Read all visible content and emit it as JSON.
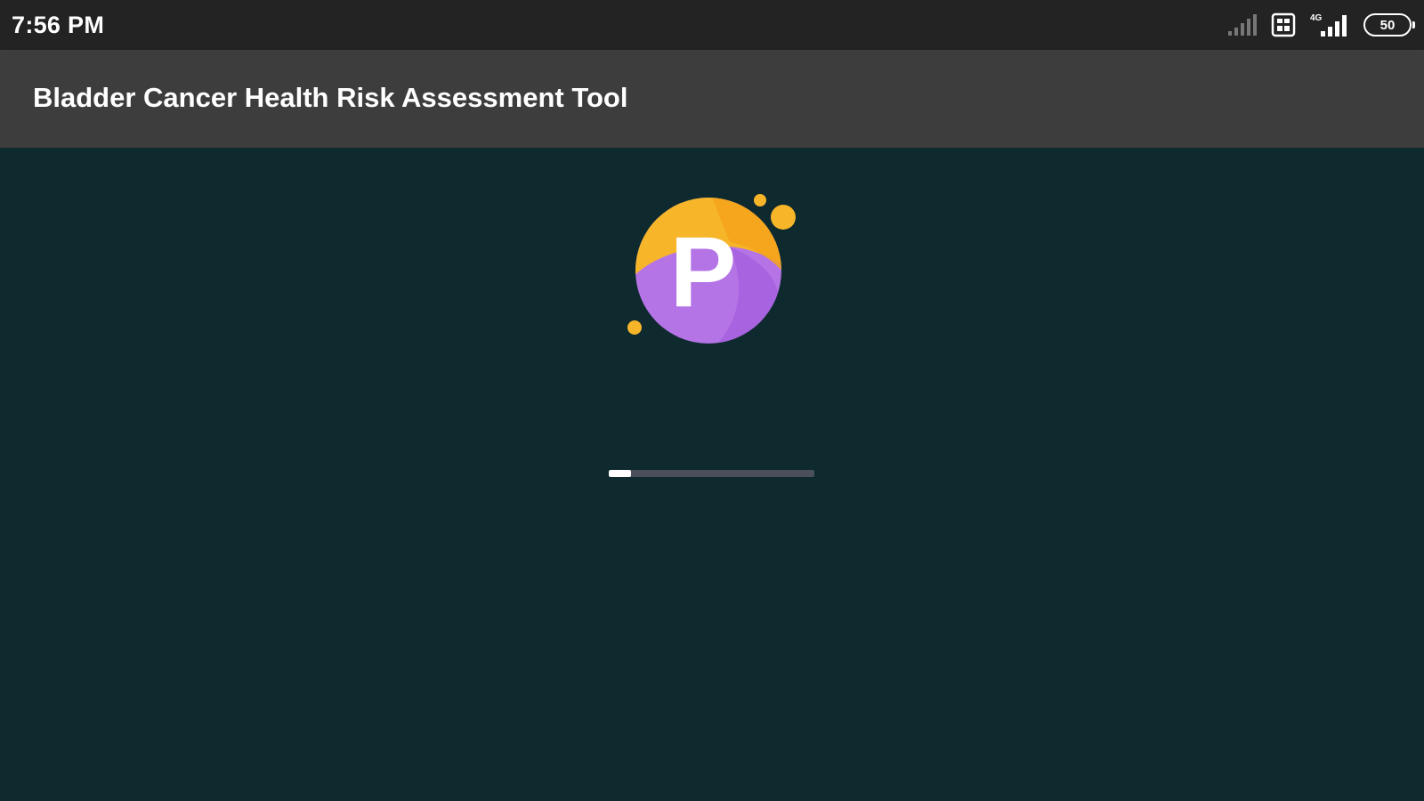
{
  "status_bar": {
    "time": "7:56 PM",
    "network_type": "4G",
    "battery_level": "50",
    "icons": [
      "signal-weak-icon",
      "sim-card-icon",
      "signal-4g-icon",
      "battery-icon"
    ]
  },
  "app_bar": {
    "title": "Bladder Cancer Health Risk Assessment Tool"
  },
  "splash": {
    "logo_letter": "P",
    "logo_icon": "app-logo-icon",
    "progress_percent": 11
  },
  "colors": {
    "status_bar_bg": "#232323",
    "app_bar_bg": "#3d3d3d",
    "content_bg": "#0e2a2e",
    "logo_yellow": "#f7b52a",
    "logo_orange": "#f4a71d",
    "logo_purple": "#b574e6",
    "progress_track": "#4b4e5b",
    "progress_fill": "#ffffff"
  }
}
